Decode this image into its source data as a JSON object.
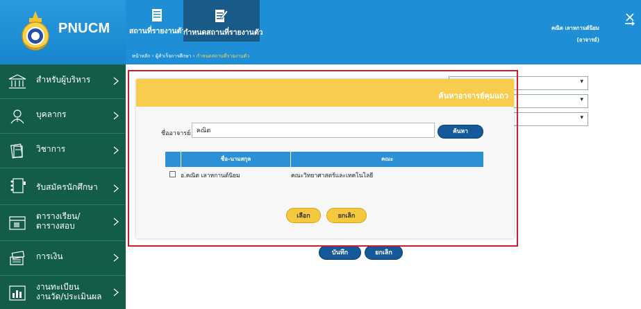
{
  "header": {
    "logo_text": "PNUCM",
    "nav": [
      {
        "label": "สถานที่รายงานตัว",
        "icon": "document-list-icon"
      },
      {
        "label": "กำหนดสถานที่รายงานตัว",
        "icon": "document-edit-icon"
      }
    ],
    "breadcrumb": {
      "home": "หน้าหลัก",
      "sep1": " › ",
      "section": "ผู้สำเร็จการศึกษา",
      "sep2": " › ",
      "current": "กำหนดสถานที่รายงานตัว"
    },
    "user": {
      "name": "คณิต เลาหกานต์นิยม",
      "role": "(อาจารย์)"
    },
    "logout_icon": "logout-icon"
  },
  "sidebar": {
    "items": [
      {
        "label": "สำหรับผู้บริหาร",
        "icon": "building-icon"
      },
      {
        "label": "บุคลากร",
        "icon": "person-icon"
      },
      {
        "label": "วิชาการ",
        "icon": "book-icon"
      },
      {
        "label": "รับสมัครนักศึกษา",
        "icon": "binder-icon"
      },
      {
        "label": "ตารางเรียน/",
        "label2": "ตารางสอบ",
        "icon": "calendar-icon"
      },
      {
        "label": "การเงิน",
        "icon": "money-icon"
      },
      {
        "label": "งานทะเบียน",
        "label2": "งานวัด/ประเมินผล",
        "icon": "chart-icon"
      }
    ]
  },
  "background_form": {
    "save_label": "บันทึก",
    "cancel_label": "ยกเลิก"
  },
  "modal": {
    "title": "ค้นหาอาจารย์คุมแถว",
    "teacher_label": "ชื่ออาจารย์",
    "teacher_value": "คณิต",
    "search_label": "ค้นหา",
    "table": {
      "headers": [
        "ชื่อ-นามสกุล",
        "คณะ"
      ],
      "rows": [
        {
          "name": "อ.คณิต เลาหกานต์นิยม",
          "faculty": "คณะวิทยาศาสตร์และเทคโนโลยี"
        }
      ]
    },
    "select_label": "เลือก",
    "cancel_label": "ยกเลิก"
  },
  "colors": {
    "header_blue": "#1e8fd6",
    "sidebar_green": "#135c47",
    "modal_yellow": "#f8cd4e",
    "highlight_red": "#d11a2a"
  }
}
